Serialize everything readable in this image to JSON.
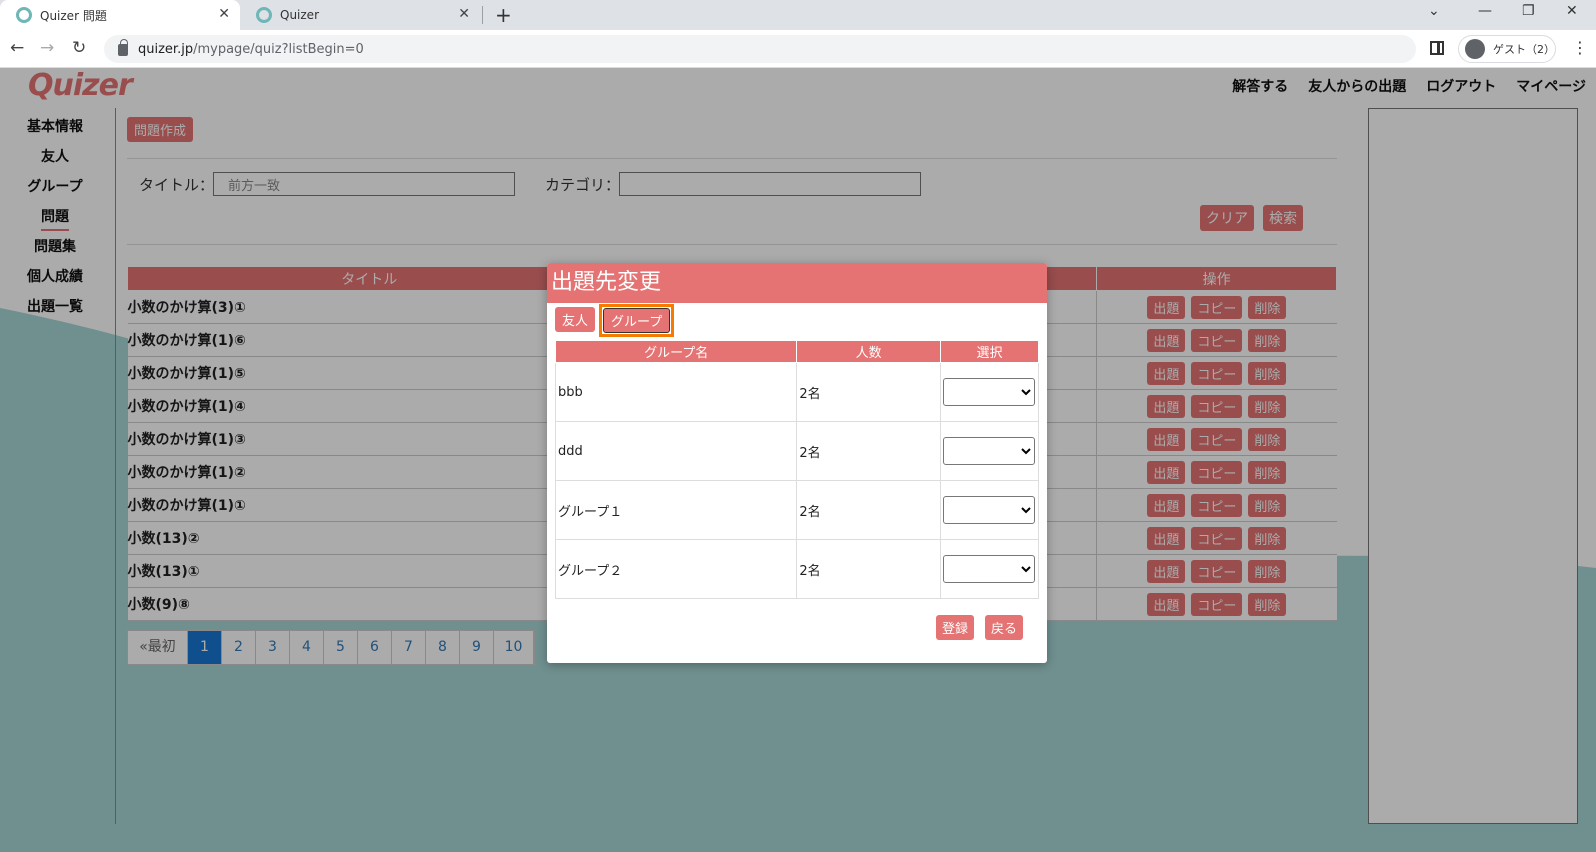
{
  "browser": {
    "tabs": [
      {
        "title": "Quizer 問題",
        "active": true
      },
      {
        "title": "Quizer",
        "active": false
      }
    ],
    "url_host": "quizer.jp",
    "url_path": "/mypage/quiz?listBegin=0",
    "profile_label": "ゲスト（2）"
  },
  "header": {
    "logo": "Quizer",
    "nav": [
      "解答する",
      "友人からの出題",
      "ログアウト",
      "マイページ"
    ]
  },
  "sidebar": {
    "items": [
      "基本情報",
      "友人",
      "グループ",
      "問題",
      "問題集",
      "個人成績",
      "出題一覧"
    ],
    "current": "問題"
  },
  "main": {
    "create_label": "問題作成",
    "search": {
      "title_label": "タイトル：",
      "title_placeholder": "前方一致",
      "category_label": "カテゴリ：",
      "clear_label": "クリア",
      "search_label": "検索"
    },
    "table": {
      "headers": [
        "タイトル",
        "操作"
      ],
      "rows": [
        "小数のかけ算(3)①",
        "小数のかけ算(1)⑥",
        "小数のかけ算(1)⑤",
        "小数のかけ算(1)④",
        "小数のかけ算(1)③",
        "小数のかけ算(1)②",
        "小数のかけ算(1)①",
        "小数(13)②",
        "小数(13)①",
        "小数(9)⑧"
      ],
      "ops": [
        "出題",
        "コピー",
        "削除"
      ]
    },
    "pager": {
      "first": "«最初",
      "pages": [
        "1",
        "2",
        "3",
        "4",
        "5",
        "6",
        "7",
        "8",
        "9",
        "10"
      ],
      "current": "1"
    }
  },
  "modal": {
    "title": "出題先変更",
    "tab_friend": "友人",
    "tab_group": "グループ",
    "headers": [
      "グループ名",
      "人数",
      "選択"
    ],
    "rows": [
      {
        "name": "bbb",
        "count": "2名"
      },
      {
        "name": "ddd",
        "count": "2名"
      },
      {
        "name": "グループ１",
        "count": "2名"
      },
      {
        "name": "グループ２",
        "count": "2名"
      }
    ],
    "register_label": "登録",
    "back_label": "戻る"
  },
  "colors": {
    "accent": "#e57373",
    "teal": "#6fa9a9",
    "highlight": "#f57c00",
    "pager_active": "#1976d2"
  }
}
